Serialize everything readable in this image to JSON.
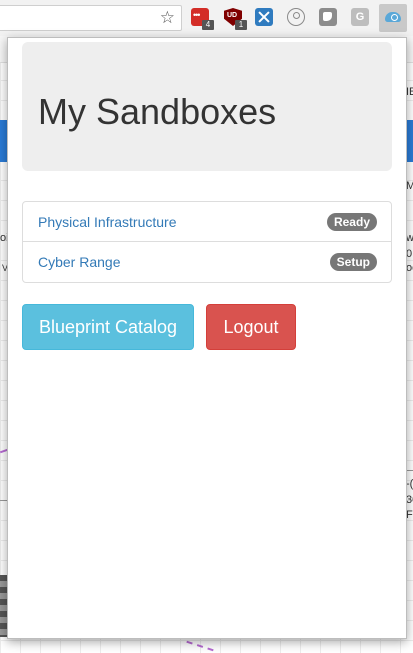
{
  "browser": {
    "extensions": [
      {
        "name": "lastpass",
        "badge": "4"
      },
      {
        "name": "ublock",
        "label": "UD",
        "badge": "1"
      },
      {
        "name": "x-extension"
      },
      {
        "name": "search-extension"
      },
      {
        "name": "note-extension"
      },
      {
        "name": "g-extension",
        "label": "G"
      },
      {
        "name": "sandbox-extension"
      }
    ]
  },
  "background": {
    "frag_1": "IE",
    "frag_2": "M",
    "frag_3": "oi",
    "frag_4": "w",
    "frag_5": "0.",
    "frag_6": "oo",
    "frag_7": "V",
    "frag_8": "-(",
    "frag_9": "30",
    "frag_10": "Fi"
  },
  "popup": {
    "title": "My Sandboxes",
    "sandboxes": [
      {
        "name": "Physical Infrastructure",
        "status": "Ready"
      },
      {
        "name": "Cyber Range",
        "status": "Setup"
      }
    ],
    "buttons": {
      "catalog": "Blueprint Catalog",
      "logout": "Logout"
    }
  },
  "colors": {
    "jumbotron_bg": "#eeeeee",
    "link": "#337ab7",
    "badge": "#777777",
    "info_button": "#5bc0de",
    "danger_button": "#d9534f"
  }
}
